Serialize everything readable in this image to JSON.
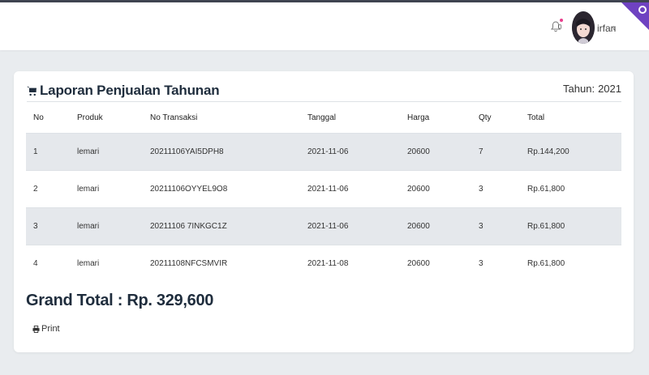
{
  "header": {
    "notification_count": "0",
    "username": "irfan",
    "caret": "v"
  },
  "report": {
    "title": "Laporan Penjualan Tahunan",
    "year_label": "Tahun:",
    "year_value": "2021",
    "columns": [
      "No",
      "Produk",
      "No Transaksi",
      "Tanggal",
      "Harga",
      "Qty",
      "Total"
    ],
    "rows": [
      [
        "1",
        "lemari",
        "20211106YAI5DPH8",
        "2021-11-06",
        "20600",
        "7",
        "Rp.144,200"
      ],
      [
        "2",
        "lemari",
        "20211106OYYEL9O8",
        "2021-11-06",
        "20600",
        "3",
        "Rp.61,800"
      ],
      [
        "3",
        "lemari",
        "20211106 7INKGC1Z",
        "2021-11-06",
        "20600",
        "3",
        "Rp.61,800"
      ],
      [
        "4",
        "lemari",
        "20211108NFCSMVIR",
        "2021-11-08",
        "20600",
        "3",
        "Rp.61,800"
      ]
    ],
    "grand_total": "Grand Total : Rp. 329,600",
    "print_label": "Print"
  },
  "colors": {
    "topbar_border": "#3f4450",
    "stripe": "#e5e8ec",
    "corner": "#6f42c1",
    "title": "#1f2d3d"
  }
}
